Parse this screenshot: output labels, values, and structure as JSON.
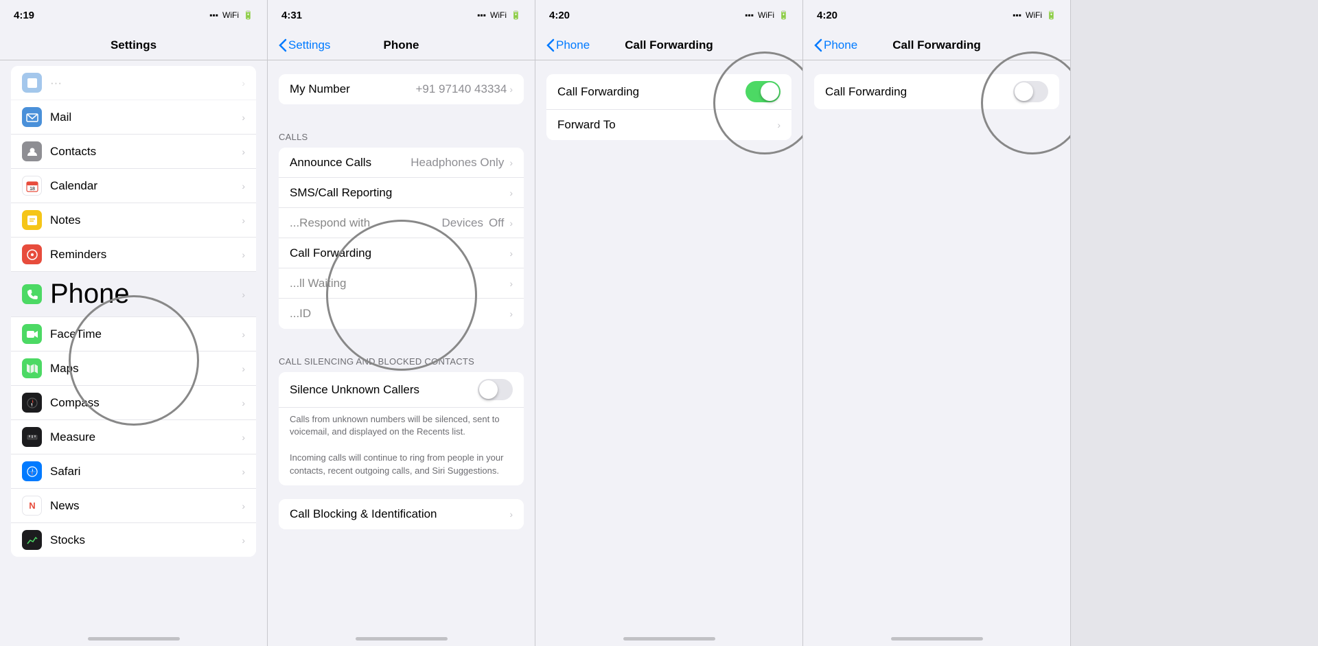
{
  "phone1": {
    "status_time": "4:19",
    "nav_title": "Settings",
    "circle_label": "Phone",
    "items": [
      {
        "icon_color": "#4a90d9",
        "icon": "mail",
        "label": "Mail"
      },
      {
        "icon_color": "#8e8e93",
        "icon": "contacts",
        "label": "Contacts"
      },
      {
        "icon_color": "#e74c3c",
        "icon": "calendar",
        "label": "Calendar"
      },
      {
        "icon_color": "#f5c518",
        "icon": "notes",
        "label": "Notes"
      },
      {
        "icon_color": "#e74c3c",
        "icon": "reminders",
        "label": "Reminders"
      },
      {
        "icon_color": "#007aff",
        "icon": "voicemail",
        "label": "Phone"
      },
      {
        "icon_color": "#007aff",
        "icon": "facetime",
        "label": "FaceTime"
      },
      {
        "icon_color": "#4cd964",
        "icon": "maps",
        "label": "Maps"
      },
      {
        "icon_color": "#000",
        "icon": "compass",
        "label": "Compass"
      },
      {
        "icon_color": "#000",
        "icon": "measure",
        "label": "Measure"
      },
      {
        "icon_color": "#007aff",
        "icon": "safari",
        "label": "Safari"
      },
      {
        "icon_color": "#e74c3c",
        "icon": "news",
        "label": "News"
      },
      {
        "icon_color": "#8e8e93",
        "icon": "stocks",
        "label": "Stocks"
      }
    ]
  },
  "phone2": {
    "status_time": "4:31",
    "nav_back": "Settings",
    "nav_title": "Phone",
    "my_number_label": "My Number",
    "my_number_value": "+91 97140 43334",
    "section_calls": "CALLS",
    "announce_calls": "Announce Calls",
    "announce_calls_value": "Headphones Only",
    "sms_call_reporting": "SMS/Call Reporting",
    "respond_with_text": "Respond with Text",
    "call_forwarding": "Call Forwarding",
    "call_waiting": "Call Waiting",
    "show_my_caller_id": "Show My Caller ID",
    "section_silencing": "CALL SILENCING AND BLOCKED CONTACTS",
    "silence_unknown": "Silence Unknown Callers",
    "silence_unknown_toggle": "off",
    "desc1": "Calls from unknown numbers will be silenced, sent to voicemail, and displayed on the Recents list.",
    "desc2": "Incoming calls will continue to ring from people in your contacts, recent outgoing calls, and Siri Suggestions.",
    "call_blocking": "Call Blocking & Identification",
    "circle_label": "Call Forwarding"
  },
  "phone3": {
    "status_time": "4:20",
    "nav_back": "Phone",
    "nav_title": "Call Forwarding",
    "call_forwarding_label": "Call Forwarding",
    "call_forwarding_toggle": "on",
    "forward_to_label": "Forward To",
    "circle_on": true
  },
  "phone4": {
    "status_time": "4:20",
    "nav_back": "Phone",
    "nav_title": "Call Forwarding",
    "call_forwarding_label": "Call Forwarding",
    "call_forwarding_toggle": "off",
    "circle_on": false
  },
  "icons": {
    "chevron": "›",
    "back_arrow": "‹"
  }
}
